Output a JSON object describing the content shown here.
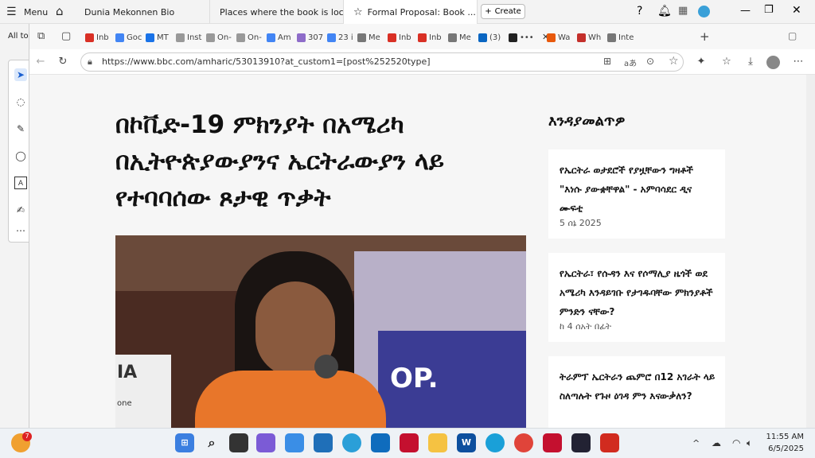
{
  "outer_tabs": {
    "menu_label": "Menu",
    "tabs": [
      {
        "label": "Dunia Mekonnen Bio"
      },
      {
        "label": "Places where the book is locate..."
      },
      {
        "label": "Formal Proposal: Book ..."
      }
    ],
    "create_label": "Create"
  },
  "left_panel": {
    "all_label": "All to"
  },
  "inner_tabs": [
    {
      "label": "Inb",
      "icon": "gmail-icon",
      "color": "#d93025"
    },
    {
      "label": "Goc",
      "icon": "google-icon",
      "color": "#4285f4"
    },
    {
      "label": "MT",
      "icon": "s-icon",
      "color": "#1a73e8"
    },
    {
      "label": "Inst",
      "icon": "loading-icon",
      "color": "#999999"
    },
    {
      "label": "On-",
      "icon": "loading-icon",
      "color": "#999999"
    },
    {
      "label": "On-",
      "icon": "loading-icon",
      "color": "#999999"
    },
    {
      "label": "Am",
      "icon": "doc-icon",
      "color": "#4285f4"
    },
    {
      "label": "307",
      "icon": "mail-icon",
      "color": "#8e6cc9"
    },
    {
      "label": "23 i",
      "icon": "search-icon",
      "color": "#4285f4"
    },
    {
      "label": "Me",
      "icon": "cube-icon",
      "color": "#777777"
    },
    {
      "label": "Inb",
      "icon": "gmail-icon",
      "color": "#d93025"
    },
    {
      "label": "Inb",
      "icon": "gmail-icon",
      "color": "#d93025"
    },
    {
      "label": "Me",
      "icon": "cube-icon",
      "color": "#777777"
    },
    {
      "label": "(3)",
      "icon": "linkedin-icon",
      "color": "#0a66c2"
    },
    {
      "label": "•••",
      "icon": "bbc-icon",
      "color": "#222222"
    },
    {
      "label": "Wa",
      "icon": "wa-icon",
      "color": "#e8590c"
    },
    {
      "label": "Wh",
      "icon": "pdf-icon",
      "color": "#c4302b"
    },
    {
      "label": "Inte",
      "icon": "globe-icon",
      "color": "#777777"
    }
  ],
  "address": {
    "url": "https://www.bbc.com/amharic/53013910?at_custom1=[post%252520type]"
  },
  "article": {
    "headline": "በኮቪድ-19 ምክንያት በአሜሪካ በኢትዮጵያውያንና ኤርትራውያን ላይ የተባባሰው ጾታዊ ጥቃት"
  },
  "sidebar": {
    "title": "እንዳያመልጥዎ",
    "cards": [
      {
        "title": "የኤርትራ ወታደሮች የያዟቸውን ግዛቶች \"እነሱ ያውቋቸዋል\" - አምባሳደር ዲና ሙፍቲ",
        "meta": "5 ሰኔ 2025"
      },
      {
        "title": "የኤርትራ፣ የሱዳን እና የሶማሊያ ዜጎች ወደ አሜሪካ እንዳይገቡ የታገዱባቸው ምክንያቶች ምንድን ናቸው?",
        "meta": "ከ 4 ሰአት በፊት"
      },
      {
        "title": "ትራምፕ ኤርትራን ጨምሮ በ12 አገራት ላይ ስለጣሉት የጉዞ ዕገዳ ምን እናውቃለን?",
        "meta": ""
      }
    ]
  },
  "hero_image": {
    "sign_text": "OP.",
    "left_sign_text": "IA",
    "left_sign_sub": "one"
  },
  "taskbar": {
    "time": "11:55 AM",
    "date": "6/5/2025",
    "badge": "7"
  }
}
